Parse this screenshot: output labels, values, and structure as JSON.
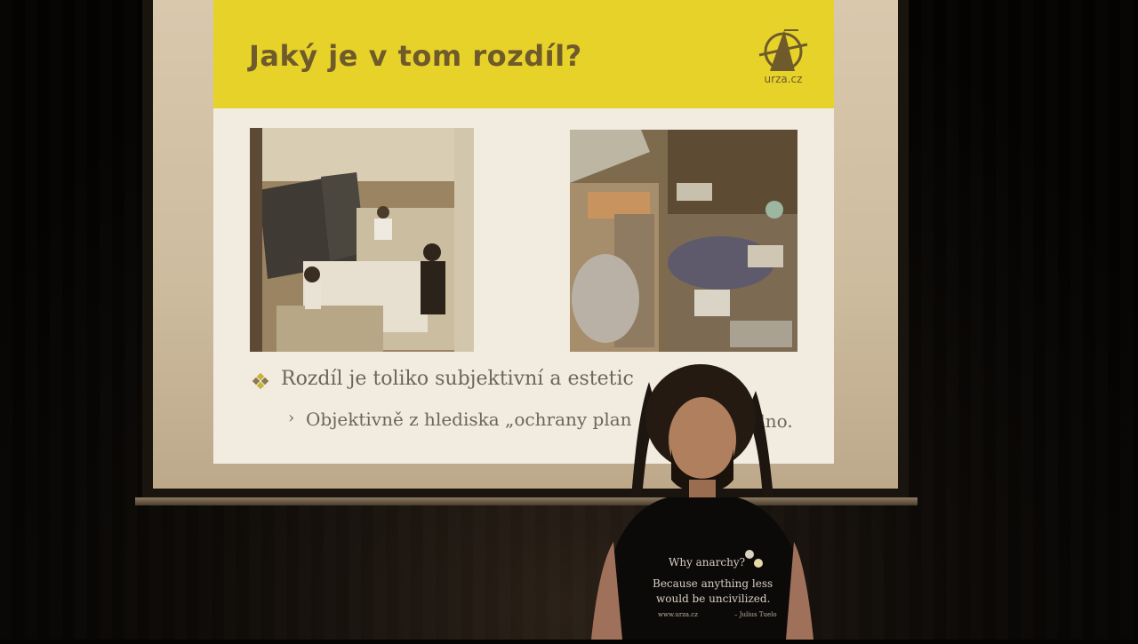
{
  "slide": {
    "title": "Jaký je v tom rozdíl?",
    "logo_text": "urza.cz",
    "bullet_1": "Rozdíl je toliko subjektivní a estetic",
    "bullet_2": "Objektivně z hlediska „ochrany plan",
    "bullet_2_tail": "dno.",
    "header_color": "#e7d22a",
    "title_color": "#6f5a2b"
  },
  "photos": {
    "left": "hackerspace-workshop-photo",
    "right": "junk-pile-photo"
  },
  "tshirt": {
    "line_1": "Why anarchy?",
    "line_2": "Because anything less",
    "line_3": "would be uncivilized.",
    "url": "www.urza.cz",
    "signature": "– Julius Tuelo"
  }
}
